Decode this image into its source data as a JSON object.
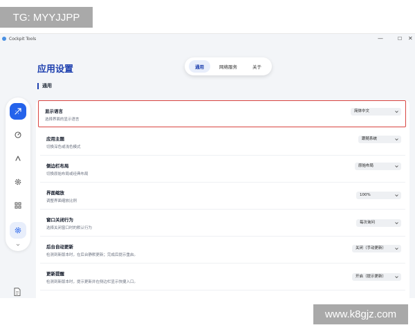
{
  "watermarks": {
    "top": "TG: MYYJJPP",
    "bottom": "www.k8gjz.com"
  },
  "window": {
    "title": "Cockpit Tools",
    "controls": {
      "minimize": "—",
      "maximize": "☐",
      "close": "✕"
    }
  },
  "page": {
    "title": "应用设置",
    "tabs": [
      {
        "label": "通用",
        "active": true
      },
      {
        "label": "网络服务"
      },
      {
        "label": "关于"
      }
    ],
    "section": "通用"
  },
  "sidebar": {
    "items": [
      {
        "icon": "rocket-icon",
        "active": true
      },
      {
        "icon": "gauge-icon"
      },
      {
        "icon": "logo-a-icon"
      },
      {
        "icon": "settings-gear-icon"
      },
      {
        "icon": "grid-icon"
      },
      {
        "icon": "settings-icon",
        "selected": true
      }
    ],
    "bottom_icon": "document-icon"
  },
  "settings": [
    {
      "title": "显示语言",
      "desc": "选择界面的显示语言",
      "value": "简体中文"
    },
    {
      "title": "应用主题",
      "desc": "切换深色或浅色模式",
      "value": "跟随系统"
    },
    {
      "title": "侧边栏布局",
      "desc": "切换原始布局或经典布局",
      "value": "原始布局"
    },
    {
      "title": "界面缩放",
      "desc": "调整界面缩放比例",
      "value": "100%"
    },
    {
      "title": "窗口关闭行为",
      "desc": "选择关闭窗口时的默认行为",
      "value": "每次询问"
    },
    {
      "title": "后台自动更新",
      "desc": "检测到新版本时，在后台静默更新；完成后提示重启。",
      "value": "关闭（手动更新）"
    },
    {
      "title": "更新提醒",
      "desc": "检测到新版本时，提示更新并在侧边栏显示快捷入口。",
      "value": "开启（提示更新）"
    }
  ],
  "colors": {
    "accent": "#1e40af",
    "highlight_border": "#d9433f"
  }
}
